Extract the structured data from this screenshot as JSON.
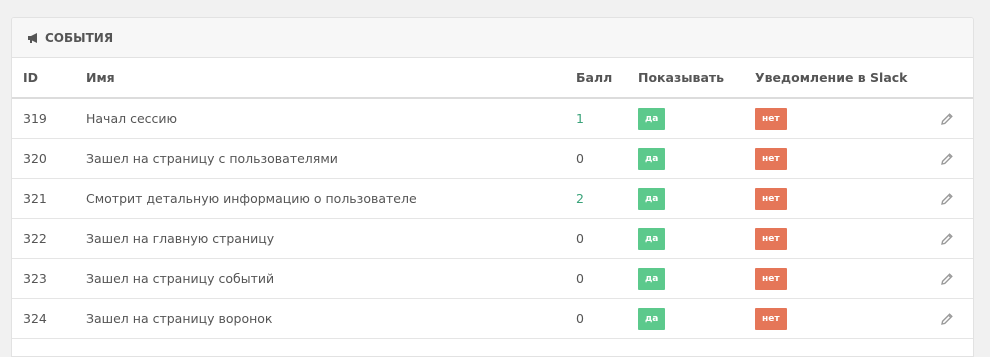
{
  "panel": {
    "title": "СОБЫТИЯ",
    "icon": "megaphone-icon"
  },
  "table": {
    "headers": {
      "id": "ID",
      "name": "Имя",
      "score": "Балл",
      "show": "Показывать",
      "slack": "Уведомление в Slack"
    },
    "rows": [
      {
        "id": "319",
        "name": "Начал сессию",
        "score": "1",
        "show": "да",
        "slack": "нет"
      },
      {
        "id": "320",
        "name": "Зашел на страницу с пользователями",
        "score": "0",
        "show": "да",
        "slack": "нет"
      },
      {
        "id": "321",
        "name": "Смотрит детальную информацию о пользователе",
        "score": "2",
        "show": "да",
        "slack": "нет"
      },
      {
        "id": "322",
        "name": "Зашел на главную страницу",
        "score": "0",
        "show": "да",
        "slack": "нет"
      },
      {
        "id": "323",
        "name": "Зашел на страницу событий",
        "score": "0",
        "show": "да",
        "slack": "нет"
      },
      {
        "id": "324",
        "name": "Зашел на страницу воронок",
        "score": "0",
        "show": "да",
        "slack": "нет"
      }
    ]
  },
  "colors": {
    "badge_yes": "#5cc98c",
    "badge_no": "#e57658",
    "score_positive": "#3aa37a"
  }
}
